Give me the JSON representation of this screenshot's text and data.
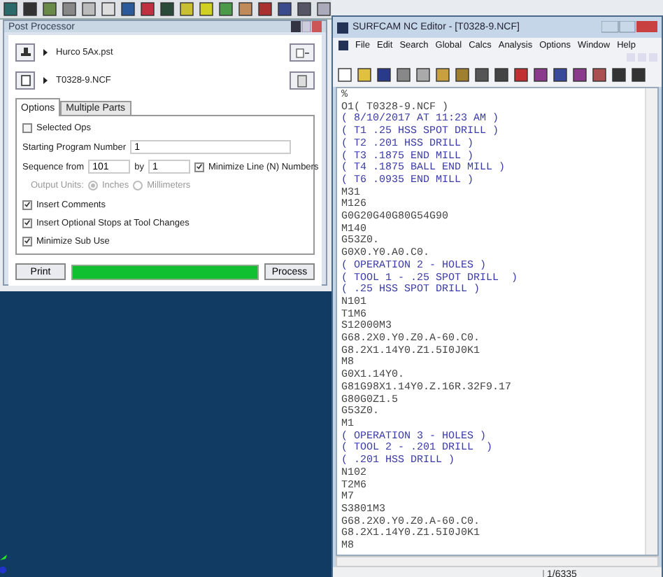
{
  "post_processor": {
    "title": "Post Processor",
    "post_file": "Hurco 5Ax.pst",
    "nc_file": "T0328-9.NCF",
    "tabs": [
      {
        "label": "Options",
        "selected": true
      },
      {
        "label": "Multiple Parts",
        "selected": false
      }
    ],
    "options": [
      {
        "kind": "checkbox",
        "label": "Selected Ops",
        "checked": false
      },
      {
        "kind": "field",
        "label": "Starting Program Number",
        "value": "1"
      },
      {
        "kind": "sequence",
        "label": "Sequence from",
        "value": "101",
        "by_label": "by",
        "by_value": "1",
        "check_label": "Minimize Line (N) Numbers",
        "checked": true
      },
      {
        "kind": "radio",
        "label": "Output Units:",
        "disabled": true,
        "choices": [
          {
            "label": "Inches",
            "selected": true
          },
          {
            "label": "Millimeters",
            "selected": false
          }
        ]
      },
      {
        "kind": "checkbox",
        "label": "Insert Comments",
        "checked": true
      },
      {
        "kind": "checkbox",
        "label": "Insert Optional Stops at Tool Changes",
        "checked": true
      },
      {
        "kind": "checkbox",
        "label": "Minimize Sub Use",
        "checked": true
      }
    ],
    "print_button": "Print",
    "progress": {
      "level": 1
    },
    "process_button": "Process"
  },
  "editor": {
    "title": "SURFCAM NC Editor - [T0328-9.NCF]",
    "menu": [
      "File",
      "Edit",
      "Search",
      "Global",
      "Calcs",
      "Analysis",
      "Options",
      "Window",
      "Help"
    ],
    "lines": [
      {
        "kind": "code",
        "text": "%"
      },
      {
        "kind": "code",
        "text": "O1( T0328-9.NCF )"
      },
      {
        "kind": "comment",
        "text": "( 8/10/2017 AT 11:23 AM )"
      },
      {
        "kind": "comment",
        "text": "( T1 .25 HSS SPOT DRILL )"
      },
      {
        "kind": "comment",
        "text": "( T2 .201 HSS DRILL )"
      },
      {
        "kind": "comment",
        "text": "( T3 .1875 END MILL )"
      },
      {
        "kind": "comment",
        "text": "( T4 .1875 BALL END MILL )"
      },
      {
        "kind": "comment",
        "text": "( T6 .0935 END MILL )"
      },
      {
        "kind": "code",
        "text": "M31"
      },
      {
        "kind": "code",
        "text": "M126"
      },
      {
        "kind": "code",
        "text": "G0G20G40G80G54G90"
      },
      {
        "kind": "code",
        "text": "M140"
      },
      {
        "kind": "code",
        "text": "G53Z0."
      },
      {
        "kind": "code",
        "text": "G0X0.Y0.A0.C0."
      },
      {
        "kind": "comment",
        "text": "( OPERATION 2 - HOLES )"
      },
      {
        "kind": "comment",
        "text": "( TOOL 1 - .25 SPOT DRILL  )"
      },
      {
        "kind": "comment",
        "text": "( .25 HSS SPOT DRILL )"
      },
      {
        "kind": "code",
        "text": "N101"
      },
      {
        "kind": "code",
        "text": "T1M6"
      },
      {
        "kind": "code",
        "text": "S12000M3"
      },
      {
        "kind": "code",
        "text": "G68.2X0.Y0.Z0.A-60.C0."
      },
      {
        "kind": "code",
        "text": "G8.2X1.14Y0.Z1.5I0J0K1"
      },
      {
        "kind": "code",
        "text": "M8"
      },
      {
        "kind": "code",
        "text": "G0X1.14Y0."
      },
      {
        "kind": "code",
        "text": "G81G98X1.14Y0.Z.16R.32F9.17"
      },
      {
        "kind": "code",
        "text": "G80G0Z1.5"
      },
      {
        "kind": "code",
        "text": "G53Z0."
      },
      {
        "kind": "code",
        "text": "M1"
      },
      {
        "kind": "comment",
        "text": "( OPERATION 3 - HOLES )"
      },
      {
        "kind": "comment",
        "text": "( TOOL 2 - .201 DRILL  )"
      },
      {
        "kind": "comment",
        "text": "( .201 HSS DRILL )"
      },
      {
        "kind": "code",
        "text": "N102"
      },
      {
        "kind": "code",
        "text": "T2M6"
      },
      {
        "kind": "code",
        "text": "M7"
      },
      {
        "kind": "code",
        "text": "S3801M3"
      },
      {
        "kind": "code",
        "text": "G68.2X0.Y0.Z0.A-60.C0."
      },
      {
        "kind": "code",
        "text": "G8.2X1.14Y0.Z1.5I0J0K1"
      },
      {
        "kind": "code",
        "text": "M8"
      }
    ],
    "status": "1/6335"
  }
}
